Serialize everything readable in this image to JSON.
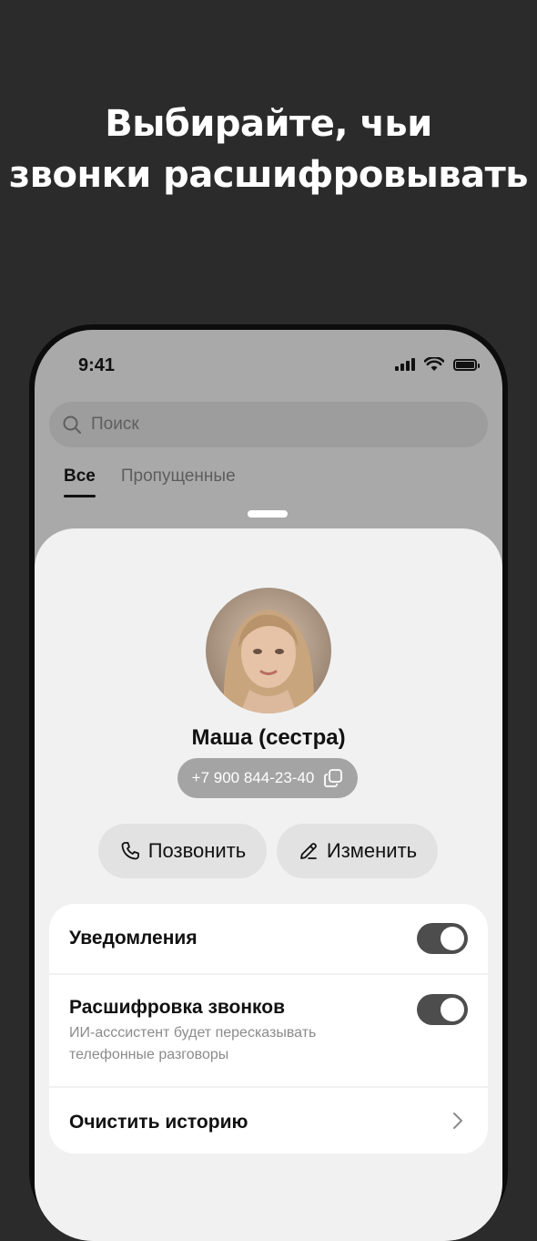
{
  "headline": {
    "line1": "Выбирайте, чьи",
    "line2": "звонки расшифровывать"
  },
  "status_bar": {
    "time": "9:41"
  },
  "search": {
    "placeholder": "Поиск"
  },
  "tabs": [
    {
      "label": "Все",
      "active": true
    },
    {
      "label": "Пропущенные",
      "active": false
    }
  ],
  "contact": {
    "name": "Маша (сестра)",
    "phone": "+7 900 844-23-40"
  },
  "actions": {
    "call_label": "Позвонить",
    "edit_label": "Изменить"
  },
  "settings": {
    "notifications": {
      "label": "Уведомления",
      "enabled": true
    },
    "transcription": {
      "label": "Расшифровка звонков",
      "description": "ИИ-асссистент будет пересказывать телефонные разговоры",
      "enabled": true
    },
    "clear_history": {
      "label": "Очистить историю"
    }
  },
  "colors": {
    "background": "#2b2b2b",
    "sheet": "#f1f1f1",
    "toggle_on": "#4d4d4d"
  }
}
